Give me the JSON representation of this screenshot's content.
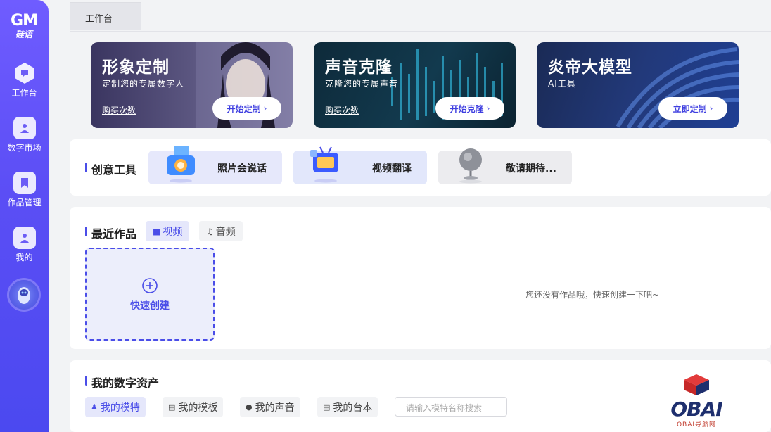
{
  "sidebar": {
    "logo_mark": "GM",
    "logo_sub": "硅语",
    "items": [
      {
        "label": "工作台",
        "icon": "chat-hexagon-icon"
      },
      {
        "label": "数字市场",
        "icon": "person-icon"
      },
      {
        "label": "作品管理",
        "icon": "bookmark-icon"
      },
      {
        "label": "我的",
        "icon": "user-icon"
      }
    ],
    "assistant_icon": "robot-avatar-icon"
  },
  "tabs": [
    {
      "label": "工作台"
    }
  ],
  "banners": [
    {
      "title": "形象定制",
      "subtitle": "定制您的专属数字人",
      "buy": "购买次数",
      "cta": "开始定制"
    },
    {
      "title": "声音克隆",
      "subtitle": "克隆您的专属声音",
      "buy": "购买次数",
      "cta": "开始克隆"
    },
    {
      "title": "炎帝大模型",
      "subtitle": "AI工具",
      "cta": "立即定制"
    }
  ],
  "tools": {
    "title": "创意工具",
    "items": [
      {
        "label": "照片会说话",
        "icon": "camera-3d-icon"
      },
      {
        "label": "视频翻译",
        "icon": "tv-translate-icon"
      },
      {
        "label": "敬请期待...",
        "icon": "globe-icon"
      }
    ]
  },
  "works": {
    "title": "最近作品",
    "tabs": [
      {
        "label": "视频",
        "icon": "video-camera-icon",
        "active": true
      },
      {
        "label": "音频",
        "icon": "music-note-icon",
        "active": false
      }
    ],
    "quick_create": "快速创建",
    "empty_text": "您还没有作品哦，快速创建一下吧~"
  },
  "assets": {
    "title": "我的数字资产",
    "tabs": [
      {
        "label": "我的模特",
        "icon": "people-icon",
        "active": true
      },
      {
        "label": "我的模板",
        "icon": "doc-icon",
        "active": false
      },
      {
        "label": "我的声音",
        "icon": "mic-icon",
        "active": false
      },
      {
        "label": "我的台本",
        "icon": "script-icon",
        "active": false
      }
    ],
    "search_placeholder": "请输入模特名称搜索"
  },
  "watermark": {
    "text": "OBAI",
    "sub": "OBAI导航网"
  },
  "colors": {
    "accent": "#4a4de8",
    "sidebar": "#5b4ef5",
    "background": "#f2f3f5"
  }
}
